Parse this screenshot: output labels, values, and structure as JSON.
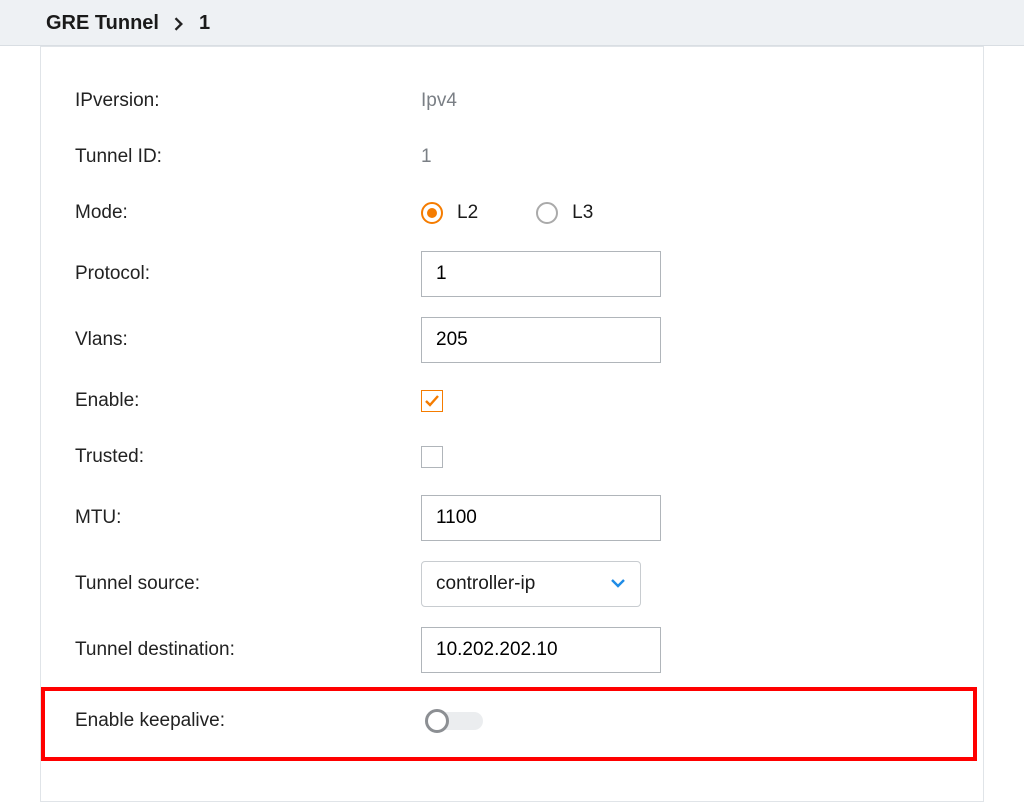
{
  "breadcrumb": {
    "parent": "GRE Tunnel",
    "current": "1"
  },
  "fields": {
    "ipversion": {
      "label": "IPversion:",
      "value": "Ipv4"
    },
    "tunnel_id": {
      "label": "Tunnel ID:",
      "value": "1"
    },
    "mode": {
      "label": "Mode:",
      "options": {
        "l2": "L2",
        "l3": "L3"
      },
      "selected": "l2"
    },
    "protocol": {
      "label": "Protocol:",
      "value": "1"
    },
    "vlans": {
      "label": "Vlans:",
      "value": "205"
    },
    "enable": {
      "label": "Enable:",
      "checked": true
    },
    "trusted": {
      "label": "Trusted:",
      "checked": false
    },
    "mtu": {
      "label": "MTU:",
      "value": "1100"
    },
    "tunnel_source": {
      "label": "Tunnel source:",
      "value": "controller-ip"
    },
    "tunnel_destination": {
      "label": "Tunnel destination:",
      "value": "10.202.202.10"
    },
    "enable_keepalive": {
      "label": "Enable keepalive:",
      "on": false
    }
  },
  "colors": {
    "accent": "#f57c00",
    "highlight": "#ff0000",
    "select_chevron": "#1f8ce6"
  }
}
